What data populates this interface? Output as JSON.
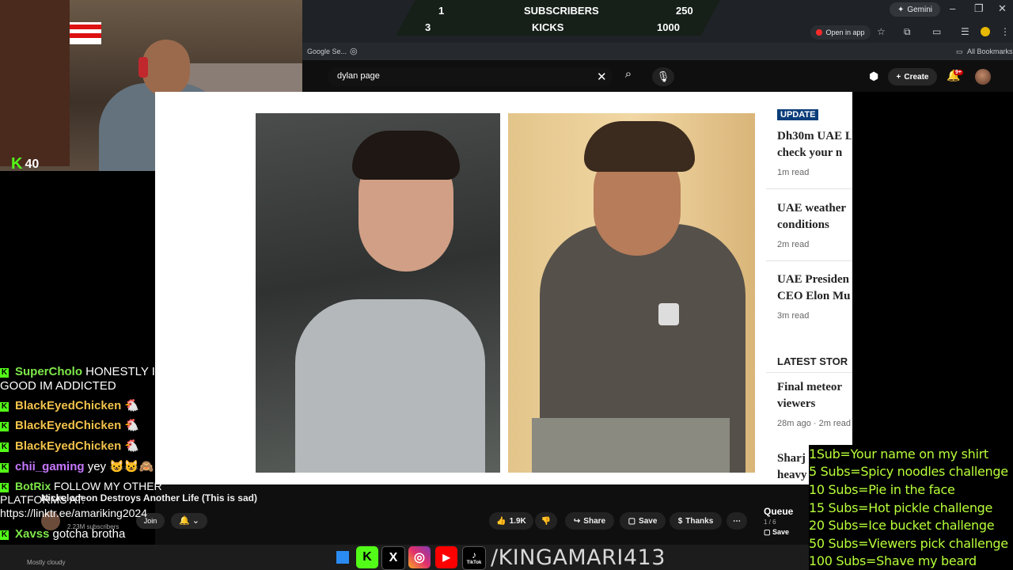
{
  "overlay": {
    "goal_rows": [
      {
        "current": "1",
        "label": "SUBSCRIBERS",
        "target": "250"
      },
      {
        "current": "3",
        "label": "KICKS",
        "target": "1000"
      }
    ],
    "webcam_kick_count": "40",
    "social_handle": "/KINGAMARI413",
    "social_icons": [
      "kick-icon",
      "x-icon",
      "instagram-icon",
      "youtube-icon",
      "tiktok-icon"
    ],
    "tiktok_label": "TikTok"
  },
  "browser": {
    "gemini_label": "Gemini",
    "open_in_app_label": "Open in app",
    "bookmark_tab": "Google Se...",
    "all_bookmarks": "All Bookmarks"
  },
  "youtube": {
    "search_value": "dylan page",
    "create_label": "Create",
    "notification_badge": "9+",
    "video_title": "Nickelodeon Destroys Another Life (This is sad)",
    "channel_subscribers": "2.23M subscribers",
    "join_label": "Join",
    "actions": {
      "likes": "1.9K",
      "share": "Share",
      "save": "Save",
      "thanks": "Thanks"
    },
    "queue": {
      "title": "Queue",
      "position": "1 / 6",
      "save": "Save"
    }
  },
  "news_sidebar": {
    "badge": "UPDATE",
    "items": [
      {
        "title_line1": "Dh30m UAE L",
        "title_line2": "check your n",
        "meta": "1m read"
      },
      {
        "title_line1": "UAE weather",
        "title_line2": "conditions",
        "meta": "2m read"
      },
      {
        "title_line1": "UAE Presiden",
        "title_line2": "CEO Elon Mu",
        "meta": "3m read"
      }
    ],
    "latest_heading": "LATEST STOR",
    "latest_items": [
      {
        "title_line1": "Final meteor",
        "title_line2": "viewers",
        "meta": "28m ago · 2m read"
      },
      {
        "title_line1": "Sharj",
        "title_line2": "heavy"
      }
    ]
  },
  "chat": [
    {
      "user": "SuperCholo",
      "text": "HONESTLY IT IS SO GOOD IM ADDICTED",
      "color": "#7ee84a"
    },
    {
      "user": "BlackEyedChicken",
      "text": "🐔",
      "color": "#f2c24b"
    },
    {
      "user": "BlackEyedChicken",
      "text": "🐔",
      "color": "#f2c24b"
    },
    {
      "user": "BlackEyedChicken",
      "text": "🐔",
      "color": "#f2c24b"
    },
    {
      "user": "chii_gaming",
      "text": "yey 😺😺🙈",
      "color": "#c678ff"
    },
    {
      "user": "BotRix",
      "text": "FOLLOW MY OTHER PLATFORMS AT: https://linktr.ee/amariking2024",
      "color": "#7ee84a"
    },
    {
      "user": "Xavss",
      "text": "gotcha brotha",
      "color": "#7ee84a"
    }
  ],
  "weather": {
    "label": "Mostly cloudy"
  },
  "challenges": [
    "1Sub=Your name on my shirt",
    "5 Subs=Spicy noodles challenge",
    "10 Subs=Pie in the face",
    "15 Subs=Hot pickle challenge",
    "20 Subs=Ice bucket challenge",
    "50 Subs=Viewers pick challenge",
    "100 Subs=Shave my beard"
  ],
  "colors": {
    "kick_green": "#53fc18",
    "challenge_green": "#b8ff3a",
    "youtube_red": "#ff0000"
  }
}
